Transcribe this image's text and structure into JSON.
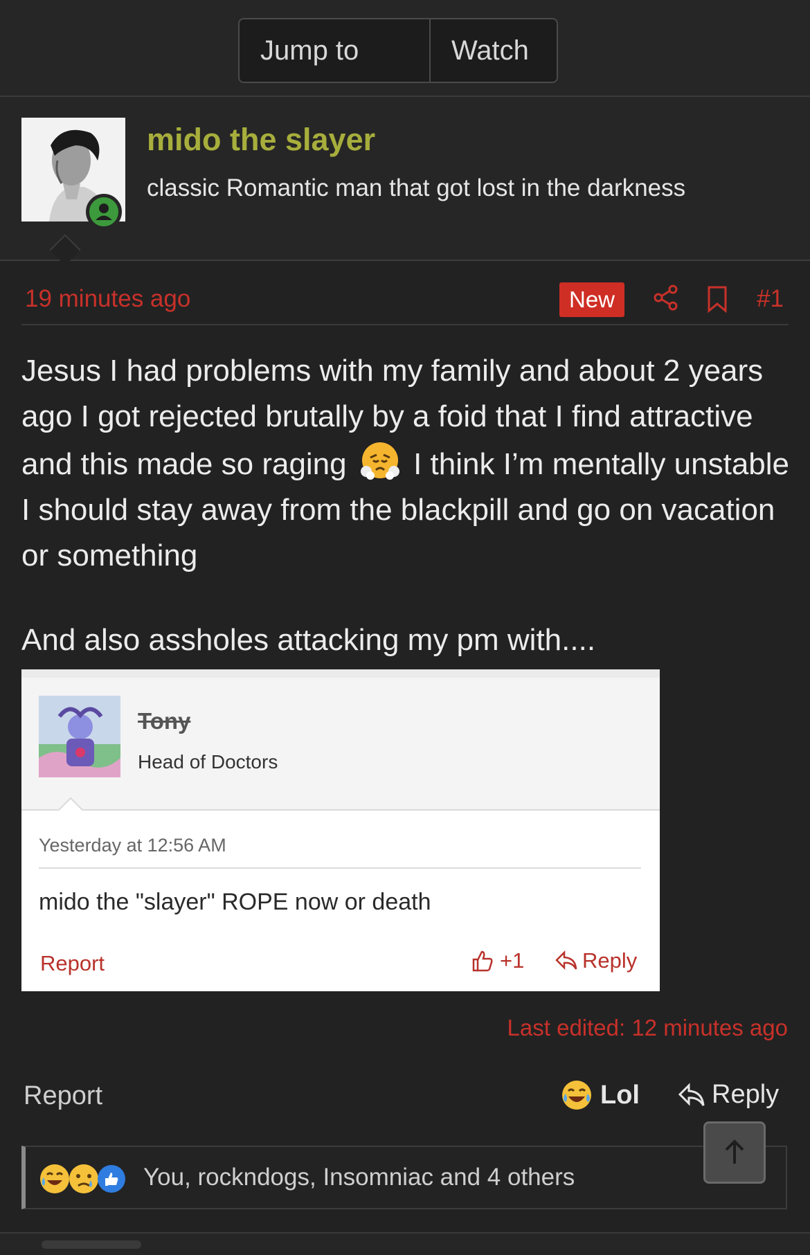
{
  "topbar": {
    "jump_label": "Jump to new",
    "watch_label": "Watch"
  },
  "author": {
    "name": "mido the slayer",
    "title": "classic Romantic man that got lost in the darkness",
    "status_color": "#3c9a3c",
    "name_color": "#a7ae3c"
  },
  "post": {
    "time": "19 minutes ago",
    "new_badge": "New",
    "number": "#1",
    "body_part1": "Jesus I had problems with my family and about 2 years ago I got rejected brutally by a foid that I find attractive and this made so raging",
    "body_emoji": "steam-from-nose-emoji",
    "body_part2": "I think I’m mentally unstable I should stay away from the blackpill and go on vacation or something",
    "body_line2": "And also assholes attacking my pm with....",
    "last_edited": "Last edited: 12 minutes ago"
  },
  "quote": {
    "name": "Tony",
    "title": "Head of Doctors",
    "time": "Yesterday at 12:56 AM",
    "text": "mido the \"slayer\" ROPE now or death",
    "report_label": "Report",
    "like_count": "+1",
    "reply_label": "Reply"
  },
  "actions": {
    "report_label": "Report",
    "lol_label": "Lol",
    "reply_label": "Reply"
  },
  "reactions": {
    "icons": [
      "laughing-crying-emoji",
      "sad-emoji",
      "thumbs-up-emoji"
    ],
    "summary": "You, rockndogs, Insomniac and 4 others"
  },
  "colors": {
    "accent": "#c8312a",
    "background": "#222222"
  }
}
